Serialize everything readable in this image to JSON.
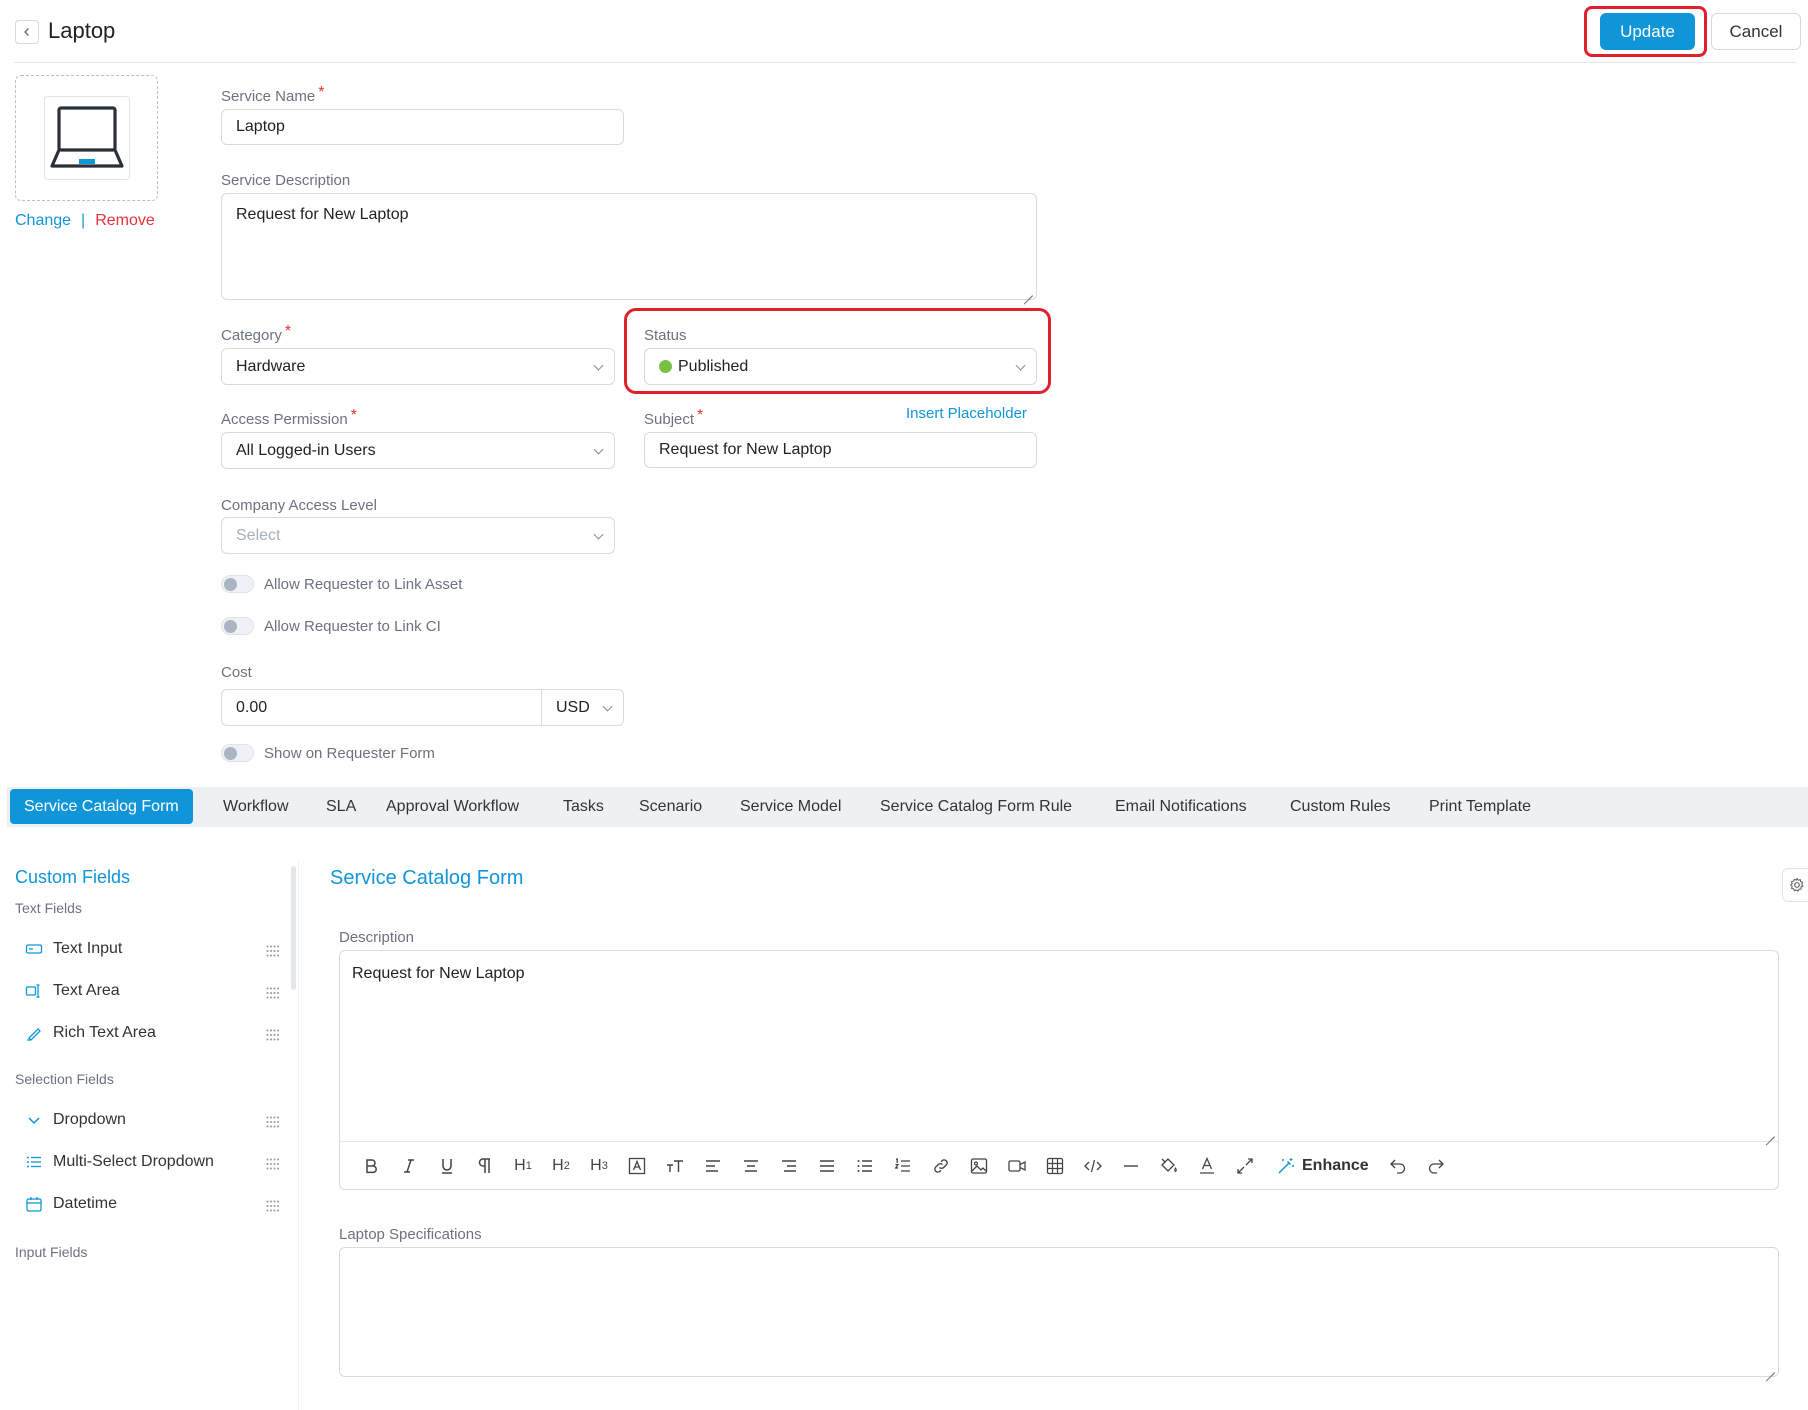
{
  "header": {
    "title": "Laptop",
    "update_label": "Update",
    "cancel_label": "Cancel"
  },
  "image": {
    "change_label": "Change",
    "separator": "|",
    "remove_label": "Remove",
    "icon": "laptop-icon"
  },
  "form": {
    "service_name": {
      "label": "Service Name",
      "value": "Laptop"
    },
    "service_description": {
      "label": "Service Description",
      "value": "Request for New Laptop"
    },
    "category": {
      "label": "Category",
      "value": "Hardware"
    },
    "status": {
      "label": "Status",
      "value": "Published",
      "dot_color": "#79c142"
    },
    "access_permission": {
      "label": "Access Permission",
      "value": "All Logged-in Users"
    },
    "subject": {
      "label": "Subject",
      "value": "Request for New Laptop",
      "insert_placeholder": "Insert Placeholder"
    },
    "company_access_level": {
      "label": "Company Access Level",
      "placeholder": "Select"
    },
    "allow_link_asset": {
      "label": "Allow Requester to Link Asset",
      "on": false
    },
    "allow_link_ci": {
      "label": "Allow Requester to Link CI",
      "on": false
    },
    "cost": {
      "label": "Cost",
      "value": "0.00",
      "currency": "USD"
    },
    "show_on_requester_form": {
      "label": "Show on Requester Form",
      "on": false
    },
    "required_mark": "*"
  },
  "tabs": [
    {
      "label": "Service Catalog Form",
      "active": true
    },
    {
      "label": "Workflow"
    },
    {
      "label": "SLA"
    },
    {
      "label": "Approval Workflow"
    },
    {
      "label": "Tasks"
    },
    {
      "label": "Scenario"
    },
    {
      "label": "Service Model"
    },
    {
      "label": "Service Catalog Form Rule"
    },
    {
      "label": "Email Notifications"
    },
    {
      "label": "Custom Rules"
    },
    {
      "label": "Print Template"
    }
  ],
  "sidebar": {
    "heading": "Custom Fields",
    "groups": {
      "text": "Text Fields",
      "selection": "Selection Fields",
      "input": "Input Fields"
    },
    "items": {
      "text_input": "Text Input",
      "text_area": "Text Area",
      "rich_text_area": "Rich Text Area",
      "dropdown": "Dropdown",
      "multi_select": "Multi-Select Dropdown",
      "datetime": "Datetime"
    }
  },
  "main": {
    "title": "Service Catalog Form",
    "description": {
      "label": "Description",
      "value": "Request for New Laptop"
    },
    "enhance_label": "Enhance",
    "h1": "H",
    "h2": "H",
    "h3": "H",
    "laptop_specs": {
      "label": "Laptop Specifications",
      "value": ""
    }
  },
  "colors": {
    "accent": "#1096d8",
    "danger": "#e5323b",
    "highlight": "#e0202a"
  }
}
